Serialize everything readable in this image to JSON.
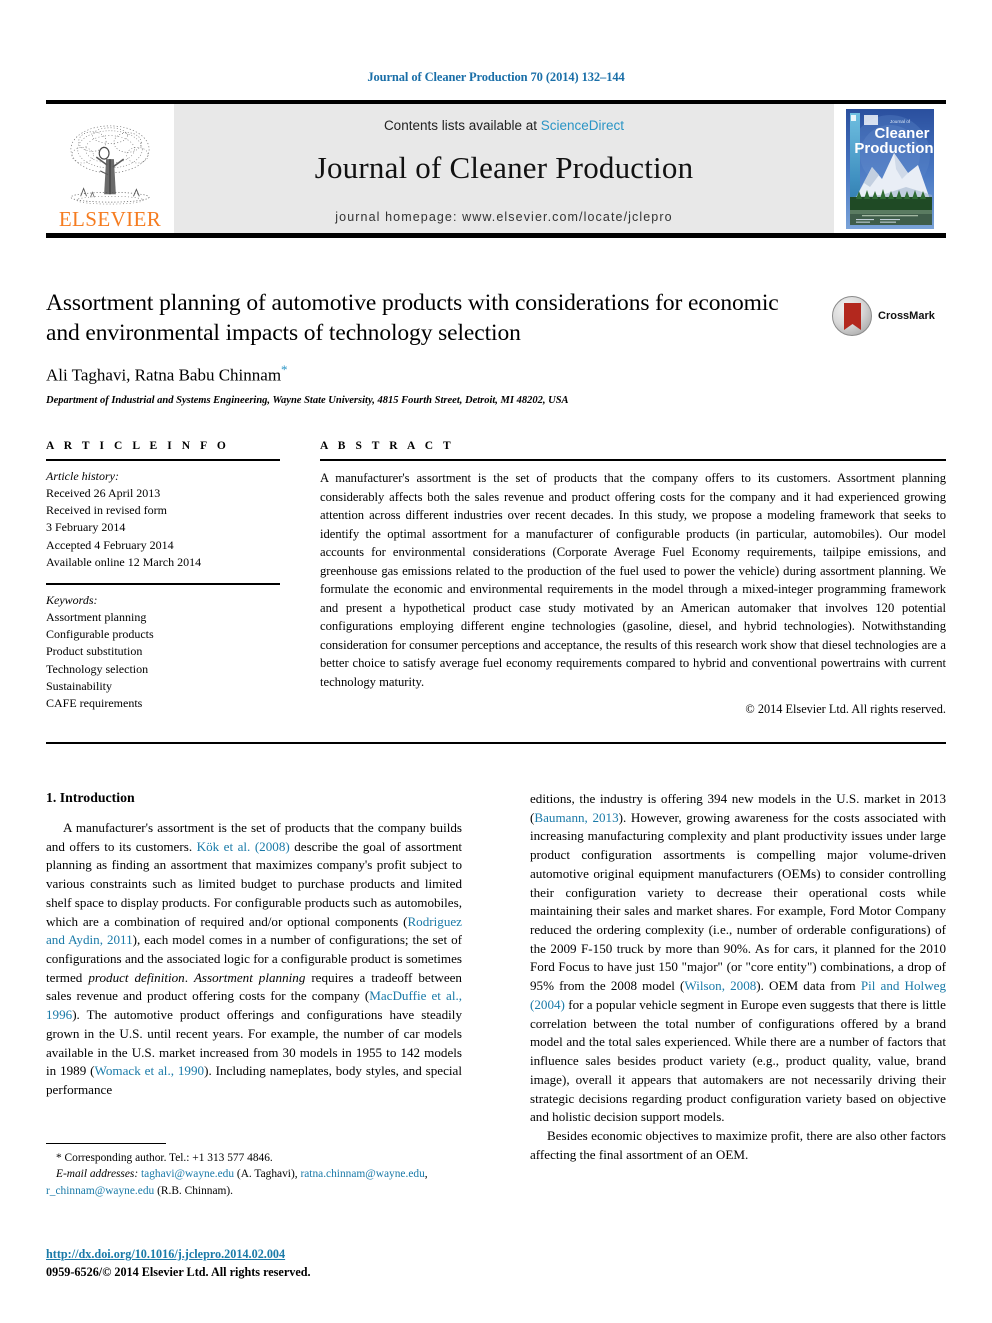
{
  "running_head": "Journal of Cleaner Production 70 (2014) 132–144",
  "masthead": {
    "contents_prefix": "Contents lists available at ",
    "sciencedirect": "ScienceDirect",
    "journal_title": "Journal of Cleaner Production",
    "homepage": "journal homepage: www.elsevier.com/locate/jclepro",
    "publisher_wordmark": "ELSEVIER",
    "cover_line1": "Journal of",
    "cover_line2": "Cleaner",
    "cover_line3": "Production"
  },
  "article": {
    "title": "Assortment planning of automotive products with considerations for economic and environmental impacts of technology selection",
    "authors": "Ali Taghavi, Ratna Babu Chinnam",
    "corresponding_marker": "*",
    "affiliation": "Department of Industrial and Systems Engineering, Wayne State University, 4815 Fourth Street, Detroit, MI 48202, USA",
    "crossmark_label": "CrossMark"
  },
  "article_info": {
    "heading": "A R T I C L E   I N F O",
    "history_label": "Article history:",
    "history": [
      "Received 26 April 2013",
      "Received in revised form",
      "3 February 2014",
      "Accepted 4 February 2014",
      "Available online 12 March 2014"
    ],
    "keywords_label": "Keywords:",
    "keywords": [
      "Assortment planning",
      "Configurable products",
      "Product substitution",
      "Technology selection",
      "Sustainability",
      "CAFE requirements"
    ]
  },
  "abstract": {
    "heading": "A B S T R A C T",
    "text": "A manufacturer's assortment is the set of products that the company offers to its customers. Assortment planning considerably affects both the sales revenue and product offering costs for the company and it had experienced growing attention across different industries over recent decades. In this study, we propose a modeling framework that seeks to identify the optimal assortment for a manufacturer of configurable products (in particular, automobiles). Our model accounts for environmental considerations (Corporate Average Fuel Economy requirements, tailpipe emissions, and greenhouse gas emissions related to the production of the fuel used to power the vehicle) during assortment planning. We formulate the economic and environmental requirements in the model through a mixed-integer programming framework and present a hypothetical product case study motivated by an American automaker that involves 120 potential configurations employing different engine technologies (gasoline, diesel, and hybrid technologies). Notwithstanding consideration for consumer perceptions and acceptance, the results of this research work show that diesel technologies are a better choice to satisfy average fuel economy requirements compared to hybrid and conventional powertrains with current technology maturity.",
    "copyright": "© 2014 Elsevier Ltd. All rights reserved."
  },
  "introduction": {
    "section_title": "1. Introduction",
    "left_p1_a": "A manufacturer's assortment is the set of products that the company builds and offers to its customers. ",
    "left_ref1": "Kök et al. (2008)",
    "left_p1_b": " describe the goal of assortment planning as finding an assortment that maximizes company's profit subject to various constraints such as limited budget to purchase products and limited shelf space to display products. For configurable products such as automobiles, which are a combination of required and/or optional components (",
    "left_ref2": "Rodriguez and Aydin, 2011",
    "left_p1_c": "), each model comes in a number of configurations; the set of configurations and the associated logic for a configurable product is sometimes termed ",
    "left_ital1": "product definition",
    "left_p1_d": ". ",
    "left_ital2": "Assortment planning",
    "left_p1_e": " requires a tradeoff between sales revenue and product offering costs for the company (",
    "left_ref3": "MacDuffie et al., 1996",
    "left_p1_f": "). The automotive product offerings and configurations have steadily grown in the U.S. until recent years. For example, the number of car models available in the U.S. market increased from 30 models in 1955 to 142 models in 1989 (",
    "left_ref4": "Womack et al., 1990",
    "left_p1_g": "). Including nameplates, body styles, and special performance",
    "right_p1_a": "editions, the industry is offering 394 new models in the U.S. market in 2013 (",
    "right_ref1": "Baumann, 2013",
    "right_p1_b": "). However, growing awareness for the costs associated with increasing manufacturing complexity and plant productivity issues under large product configuration assortments is compelling major volume-driven automotive original equipment manufacturers (OEMs) to consider controlling their configuration variety to decrease their operational costs while maintaining their sales and market shares. For example, Ford Motor Company reduced the ordering complexity (i.e., number of orderable configurations) of the 2009 F-150 truck by more than 90%. As for cars, it planned for the 2010 Ford Focus to have just 150 \"major\" (or \"core entity\") combinations, a drop of 95% from the 2008 model (",
    "right_ref2": "Wilson, 2008",
    "right_p1_c": "). OEM data from ",
    "right_ref3": "Pil and Holweg (2004)",
    "right_p1_d": " for a popular vehicle segment in Europe even suggests that there is little correlation between the total number of configurations offered by a brand model and the total sales experienced. While there are a number of factors that influence sales besides product variety (e.g., product quality, value, brand image), overall it appears that automakers are not necessarily driving their strategic decisions regarding product configuration variety based on objective and holistic decision support models.",
    "right_p2": "Besides economic objectives to maximize profit, there are also other factors affecting the final assortment of an OEM."
  },
  "footnote": {
    "corresponding": "* Corresponding author. Tel.: +1 313 577 4846.",
    "email_label": "E-mail addresses:",
    "email1": "taghavi@wayne.edu",
    "email1_name": " (A. Taghavi), ",
    "email2": "ratna.chinnam@wayne.edu",
    "email2_sep": ",",
    "email3": "r_chinnam@wayne.edu",
    "email3_name": " (R.B. Chinnam)."
  },
  "footer": {
    "doi": "http://dx.doi.org/10.1016/j.jclepro.2014.02.004",
    "issn": "0959-6526/© 2014 Elsevier Ltd. All rights reserved."
  },
  "colors": {
    "link_blue": "#1a7aa8",
    "sciencedirect_blue": "#2a95c5",
    "elsevier_orange": "#F57C20",
    "band_gray": "#e8e8e8"
  }
}
